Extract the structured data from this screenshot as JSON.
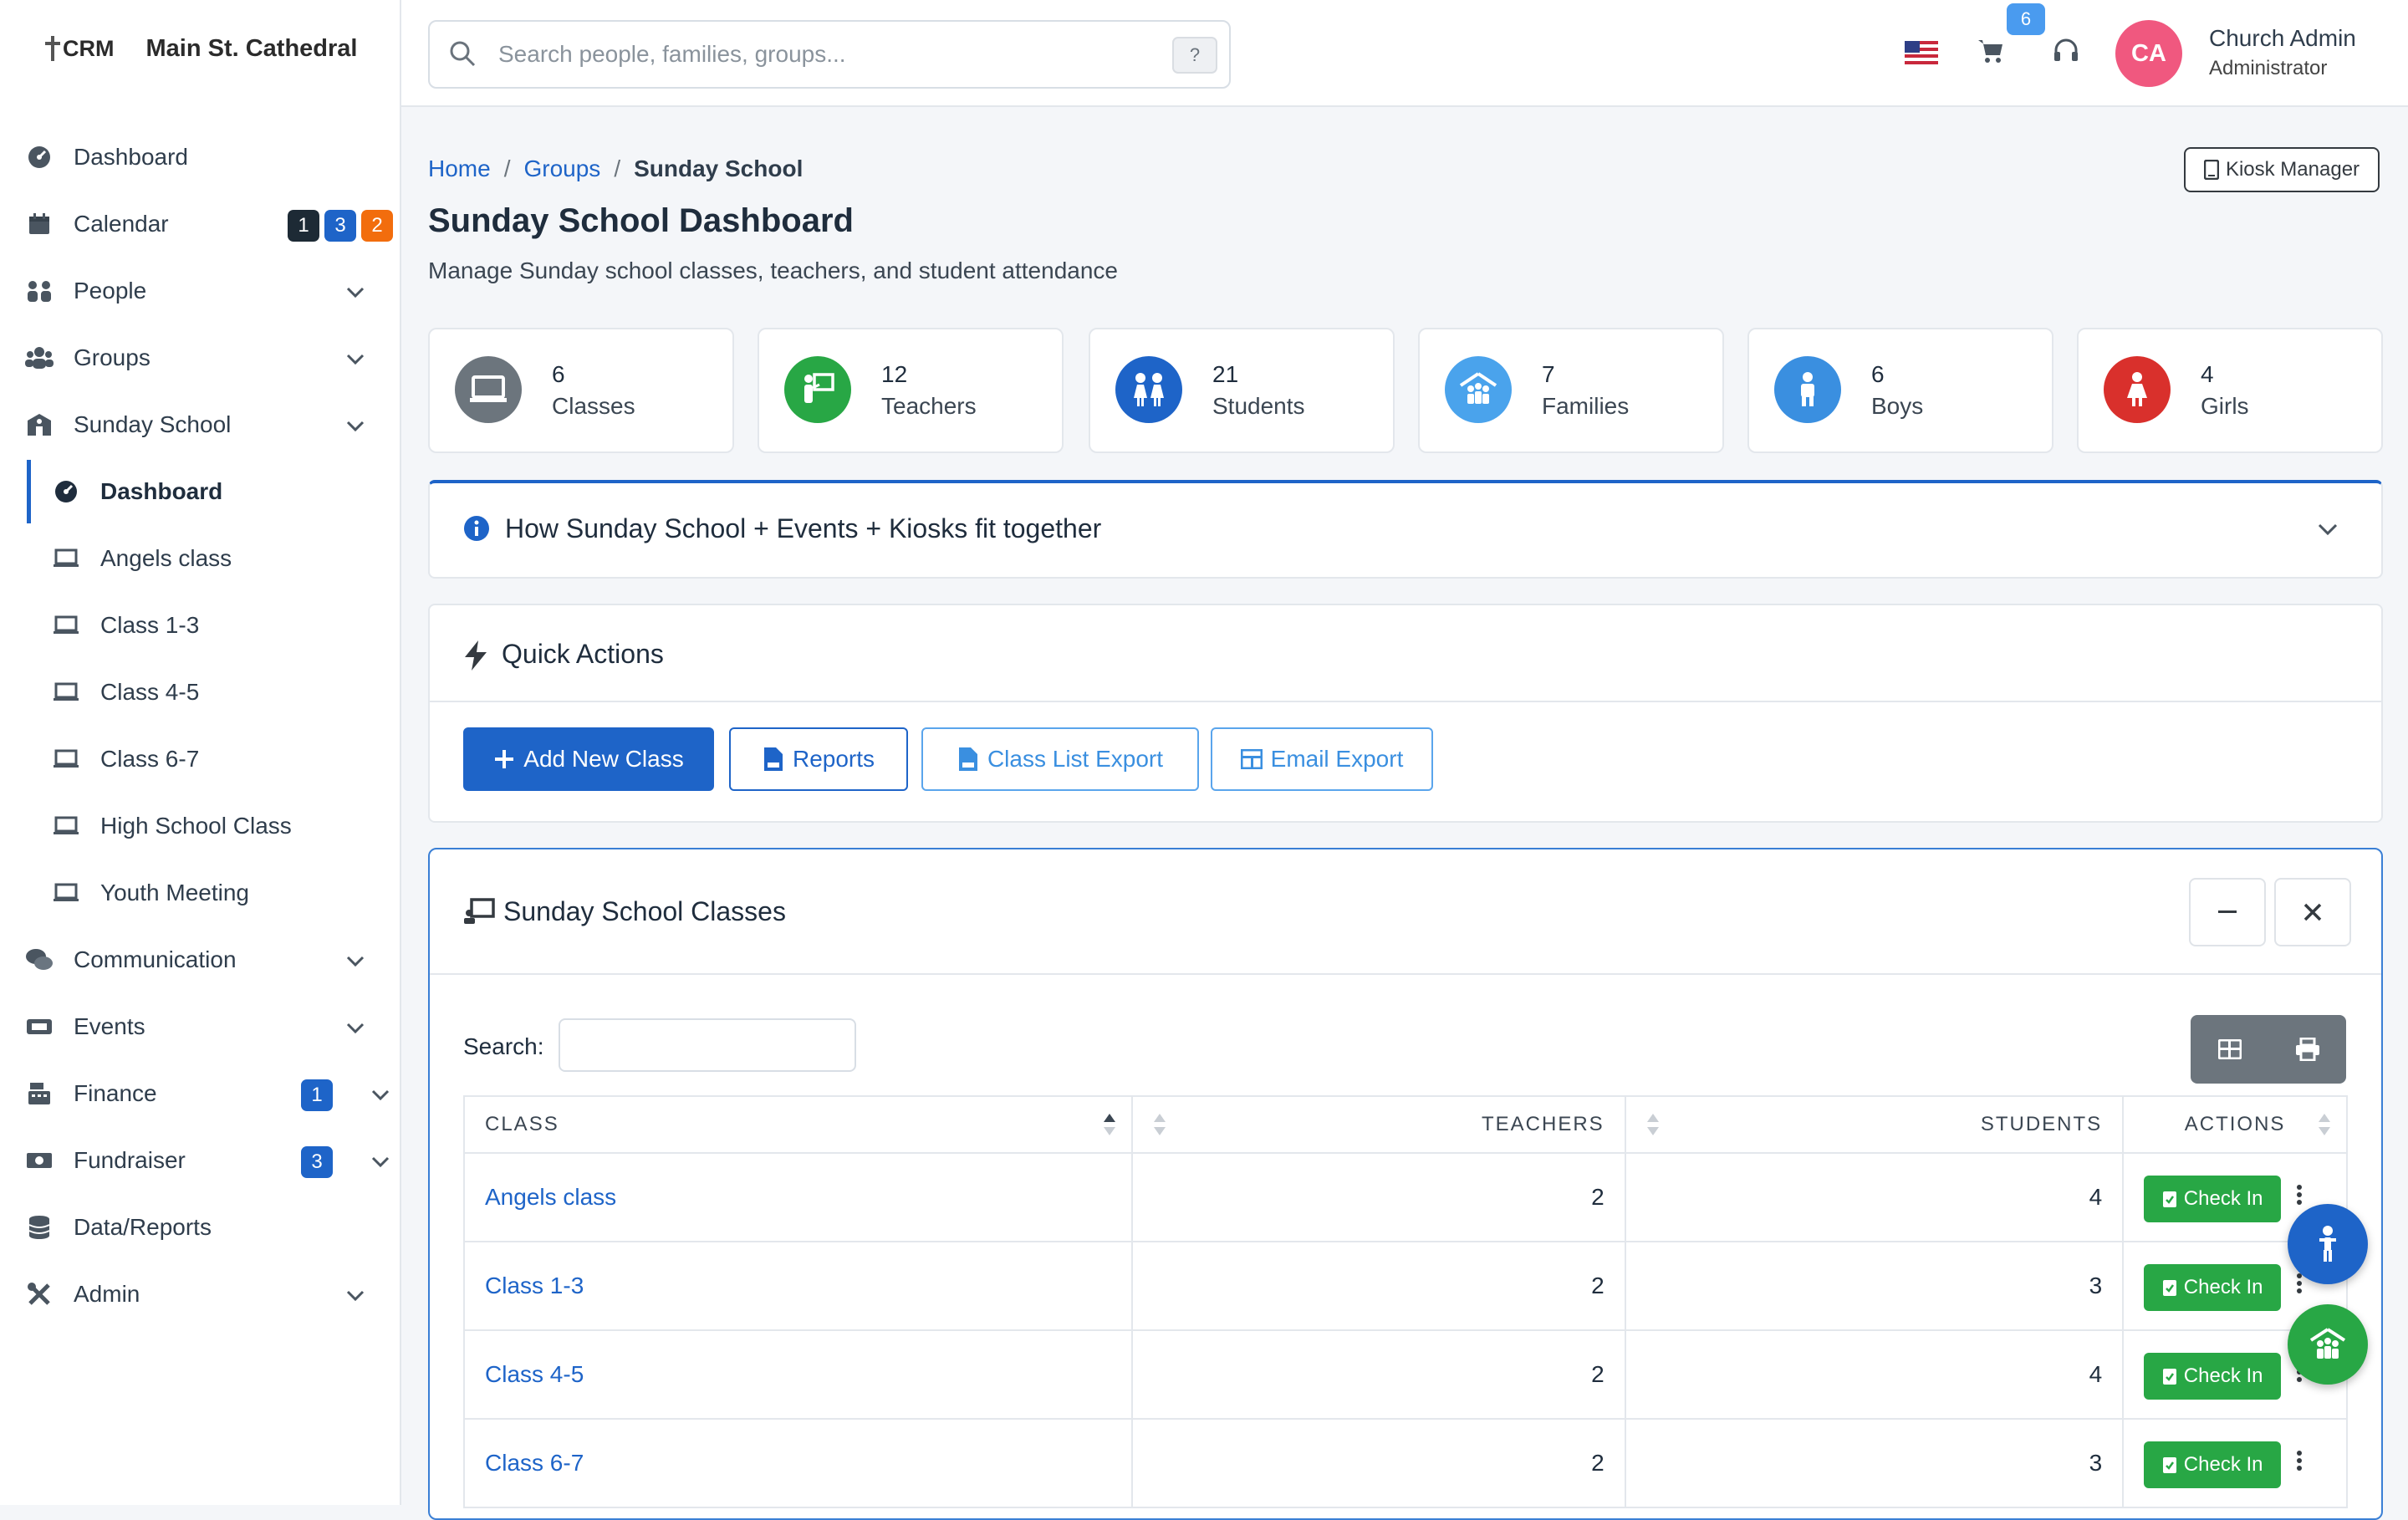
{
  "brand": {
    "logo_text": "CRM",
    "church_name": "Main St. Cathedral"
  },
  "sidebar": {
    "items": [
      {
        "label": "Dashboard"
      },
      {
        "label": "Calendar",
        "badges": [
          "1",
          "3",
          "2"
        ]
      },
      {
        "label": "People"
      },
      {
        "label": "Groups"
      },
      {
        "label": "Sunday School"
      },
      {
        "label": "Communication"
      },
      {
        "label": "Events"
      },
      {
        "label": "Finance",
        "badge": "1"
      },
      {
        "label": "Fundraiser",
        "badge": "3"
      },
      {
        "label": "Data/Reports"
      },
      {
        "label": "Admin"
      }
    ],
    "sunday_school_sub": [
      {
        "label": "Dashboard"
      },
      {
        "label": "Angels class"
      },
      {
        "label": "Class 1-3"
      },
      {
        "label": "Class 4-5"
      },
      {
        "label": "Class 6-7"
      },
      {
        "label": "High School Class"
      },
      {
        "label": "Youth Meeting"
      }
    ]
  },
  "topbar": {
    "search_placeholder": "Search people, families, groups...",
    "search_shortcut": "?",
    "cart_count": "6",
    "user": {
      "initials": "CA",
      "name": "Church Admin",
      "role": "Administrator"
    }
  },
  "breadcrumb": {
    "home": "Home",
    "groups": "Groups",
    "current": "Sunday School"
  },
  "kiosk_button": "Kiosk Manager",
  "page": {
    "title": "Sunday School Dashboard",
    "subtitle": "Manage Sunday school classes, teachers, and student attendance"
  },
  "stats": [
    {
      "value": "6",
      "label": "Classes",
      "color": "#6c757d"
    },
    {
      "value": "12",
      "label": "Teachers",
      "color": "#28a745"
    },
    {
      "value": "21",
      "label": "Students",
      "color": "#1e64c8"
    },
    {
      "value": "7",
      "label": "Families",
      "color": "#4aa3ec"
    },
    {
      "value": "6",
      "label": "Boys",
      "color": "#3a8fe0"
    },
    {
      "value": "4",
      "label": "Girls",
      "color": "#d9302c"
    }
  ],
  "info_panel": {
    "title": "How Sunday School + Events + Kiosks fit together"
  },
  "quick_actions": {
    "title": "Quick Actions",
    "add_class": "Add New Class",
    "reports": "Reports",
    "class_list_export": "Class List Export",
    "email_export": "Email Export"
  },
  "classes_panel": {
    "title": "Sunday School Classes",
    "search_label": "Search:",
    "columns": {
      "class": "CLASS",
      "teachers": "TEACHERS",
      "students": "STUDENTS",
      "actions": "ACTIONS"
    },
    "checkin_label": "Check In",
    "rows": [
      {
        "name": "Angels class",
        "teachers": "2",
        "students": "4"
      },
      {
        "name": "Class 1-3",
        "teachers": "2",
        "students": "3"
      },
      {
        "name": "Class 4-5",
        "teachers": "2",
        "students": "4"
      },
      {
        "name": "Class 6-7",
        "teachers": "2",
        "students": "3"
      }
    ]
  },
  "colors": {
    "primary": "#1e64c8",
    "success": "#28a745",
    "avatar": "#f0587f"
  }
}
